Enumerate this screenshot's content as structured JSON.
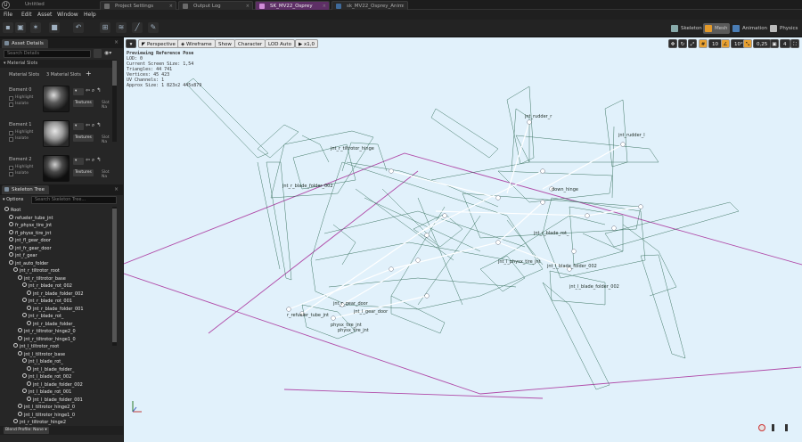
{
  "tabs": {
    "app_title": "Untitled",
    "items": [
      "Project Settings",
      "Output Log",
      "SK_MV22_Osprey",
      "sk_MV22_Osprey_Anim"
    ]
  },
  "menu": [
    "File",
    "Edit",
    "Asset",
    "Window",
    "Help"
  ],
  "modes": {
    "skeleton": "Skeleton",
    "mesh": "Mesh",
    "animation": "Animation",
    "physics": "Physics"
  },
  "asset_details": {
    "tab": "Asset Details",
    "search_placeholder": "Search Details",
    "material_slots_header": "Material Slots",
    "material_slots_label": "Material Slots",
    "material_slots_count": "3 Material Slots",
    "elements": [
      {
        "name": "Element 0",
        "highlight": "Highlight",
        "isolate": "Isolate",
        "textures": "Textures",
        "slot": "Slot Na"
      },
      {
        "name": "Element 1",
        "highlight": "Highlight",
        "isolate": "Isolate",
        "textures": "Textures",
        "slot": "Slot Na"
      },
      {
        "name": "Element 2",
        "highlight": "Highlight",
        "isolate": "Isolate",
        "textures": "Textures",
        "slot": "Slot Na"
      }
    ]
  },
  "skeleton_tree": {
    "tab": "Skeleton Tree",
    "options": "Options",
    "search_placeholder": "Search Skeleton Tree...",
    "blend_profile": "Blend Profile: None",
    "bones": [
      {
        "name": "Root",
        "depth": 0
      },
      {
        "name": "refueler_tube_jnt",
        "depth": 1
      },
      {
        "name": "fr_physx_tire_jnt",
        "depth": 1
      },
      {
        "name": "fl_physx_tire_jnt",
        "depth": 1
      },
      {
        "name": "jnt_fl_gear_door",
        "depth": 1
      },
      {
        "name": "jnt_fr_gear_door",
        "depth": 1
      },
      {
        "name": "jnt_f_gear",
        "depth": 1
      },
      {
        "name": "jnt_auto_folder",
        "depth": 1
      },
      {
        "name": "jnt_r_tiltrotor_root",
        "depth": 2
      },
      {
        "name": "jnt_r_tiltrotor_base",
        "depth": 3
      },
      {
        "name": "jnt_r_blade_rot_002",
        "depth": 4
      },
      {
        "name": "jnt_r_blade_folder_002",
        "depth": 5
      },
      {
        "name": "jnt_r_blade_rot_001",
        "depth": 4
      },
      {
        "name": "jnt_r_blade_folder_001",
        "depth": 5
      },
      {
        "name": "jnt_r_blade_rot_",
        "depth": 4
      },
      {
        "name": "jnt_r_blade_folder_",
        "depth": 5
      },
      {
        "name": "jnt_r_tiltrotor_hinge2_0",
        "depth": 3
      },
      {
        "name": "jnt_r_tiltrotor_hinge1_0",
        "depth": 3
      },
      {
        "name": "jnt_l_tiltrotor_root",
        "depth": 2
      },
      {
        "name": "jnt_l_tiltrotor_base",
        "depth": 3
      },
      {
        "name": "jnt_l_blade_rot_",
        "depth": 4
      },
      {
        "name": "jnt_l_blade_folder_",
        "depth": 5
      },
      {
        "name": "jnt_l_blade_rot_002",
        "depth": 4
      },
      {
        "name": "jnt_l_blade_folder_002",
        "depth": 5
      },
      {
        "name": "jnt_l_blade_rot_001",
        "depth": 4
      },
      {
        "name": "jnt_l_blade_folder_001",
        "depth": 5
      },
      {
        "name": "jnt_l_tiltrotor_hinge2_0",
        "depth": 3
      },
      {
        "name": "jnt_l_tiltrotor_hinge1_0",
        "depth": 3
      },
      {
        "name": "jnt_r_tiltrotor_hinge2",
        "depth": 2
      }
    ]
  },
  "viewport": {
    "perspective": "Perspective",
    "wireframe": "Wireframe",
    "show": "Show",
    "character": "Character",
    "lod": "LOD Auto",
    "speed": "x1,0",
    "grid_snap": "10",
    "rot_snap": "10°",
    "scale_snap": "0,25",
    "cam_speed": "4",
    "info": [
      "Previewing Reference Pose",
      "LOD: 0",
      "Current Screen Size: 1,54",
      "Triangles: 44 741",
      "Vertices: 45 423",
      "UV Channels: 1",
      "Approx Size: 1 823x2 445x879"
    ],
    "bone_labels": [
      "jnt_rudder_r",
      "jnt_rudder_l",
      "jnt_r_tiltrotor_hinge",
      "jnt_r_blade_folder_002",
      "jnt_l_gear_door",
      "physx_tire_jnt",
      "physx_tire_jnt",
      "jnt_l_blade_folder_002",
      "jnt_l_blade_folder_002",
      "jnt_r_blade_rot_",
      "jnt_l_physx_tire_jnt",
      "r_refueler_tube_jnt",
      "jnt_r_gear_door",
      "down_hinge"
    ]
  },
  "colors": {
    "wire": "#2f6a55",
    "viewport_bg": "#e1f1fb",
    "accent": "#f0a020",
    "purple_tab": "#5e2f66"
  }
}
